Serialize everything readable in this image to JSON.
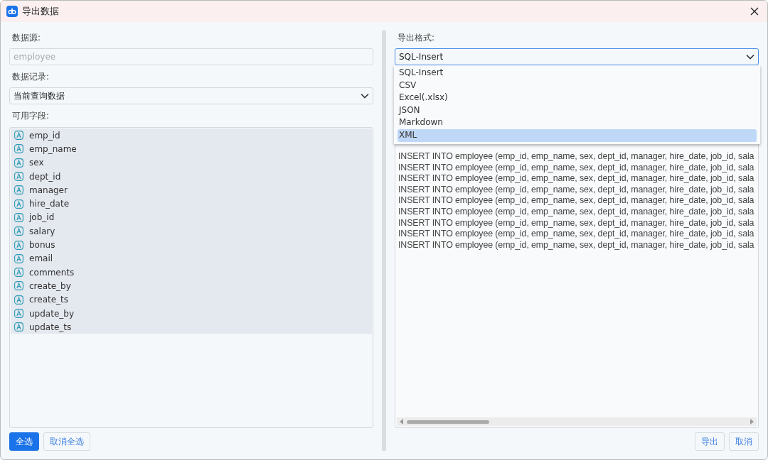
{
  "window": {
    "title": "导出数据"
  },
  "left": {
    "source": {
      "label": "数据源:",
      "placeholder": "employee"
    },
    "records": {
      "label": "数据记录:",
      "value": "当前查询数据"
    },
    "fields": {
      "label": "可用字段:",
      "items": [
        {
          "name": "emp_id",
          "selected": true
        },
        {
          "name": "emp_name",
          "selected": true
        },
        {
          "name": "sex",
          "selected": true
        },
        {
          "name": "dept_id",
          "selected": true
        },
        {
          "name": "manager",
          "selected": true
        },
        {
          "name": "hire_date",
          "selected": true
        },
        {
          "name": "job_id",
          "selected": true
        },
        {
          "name": "salary",
          "selected": true
        },
        {
          "name": "bonus",
          "selected": true
        },
        {
          "name": "email",
          "selected": true
        },
        {
          "name": "comments",
          "selected": true
        },
        {
          "name": "create_by",
          "selected": true
        },
        {
          "name": "create_ts",
          "selected": true
        },
        {
          "name": "update_by",
          "selected": true
        },
        {
          "name": "update_ts",
          "selected": true
        }
      ]
    },
    "buttons": [
      {
        "label": "全选",
        "kind": "primary"
      },
      {
        "label": "取消全选",
        "kind": "default"
      }
    ]
  },
  "right": {
    "format": {
      "label": "导出格式:",
      "value": "SQL-Insert",
      "expanded": true,
      "options": [
        {
          "label": "SQL-Insert",
          "highlighted": false
        },
        {
          "label": "CSV",
          "highlighted": false
        },
        {
          "label": "Excel(.xlsx)",
          "highlighted": false
        },
        {
          "label": "JSON",
          "highlighted": false
        },
        {
          "label": "Markdown",
          "highlighted": false
        },
        {
          "label": "XML",
          "highlighted": true
        }
      ]
    },
    "preview": {
      "lines": [
        "INSERT INTO employee (emp_id, emp_name, sex, dept_id, manager, hire_date, job_id, sala",
        "INSERT INTO employee (emp_id, emp_name, sex, dept_id, manager, hire_date, job_id, sala",
        "INSERT INTO employee (emp_id, emp_name, sex, dept_id, manager, hire_date, job_id, sala",
        "INSERT INTO employee (emp_id, emp_name, sex, dept_id, manager, hire_date, job_id, sala",
        "INSERT INTO employee (emp_id, emp_name, sex, dept_id, manager, hire_date, job_id, sala",
        "INSERT INTO employee (emp_id, emp_name, sex, dept_id, manager, hire_date, job_id, sala",
        "INSERT INTO employee (emp_id, emp_name, sex, dept_id, manager, hire_date, job_id, sala",
        "INSERT INTO employee (emp_id, emp_name, sex, dept_id, manager, hire_date, job_id, sala",
        "INSERT INTO employee (emp_id, emp_name, sex, dept_id, manager, hire_date, job_id, sala"
      ]
    },
    "buttons": [
      "导出",
      "取消"
    ]
  }
}
